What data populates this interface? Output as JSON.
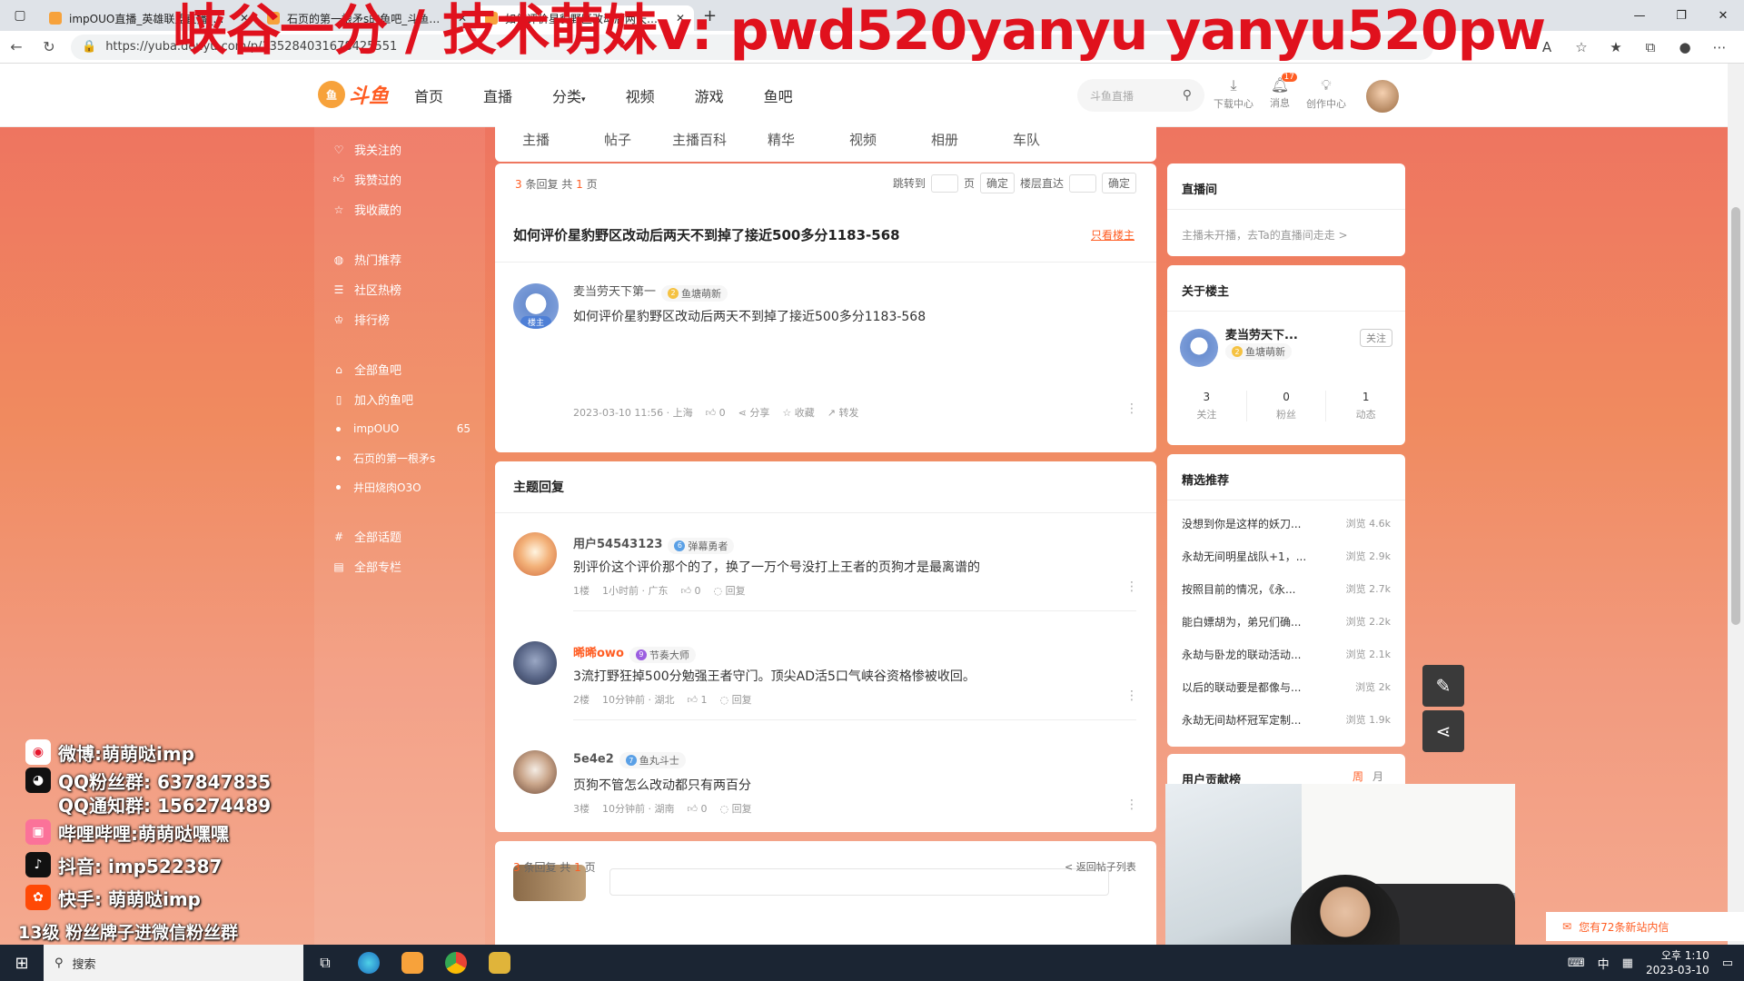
{
  "overlay_title": "峡谷一分 / 技术萌妹v: pwd520yanyu yanyu520pw",
  "browser": {
    "tabs": [
      {
        "title": "impOUO直播_英雄联盟直播_斗鱼直播",
        "active": false
      },
      {
        "title": "石页的第一根矛s的鱼吧_斗鱼直播",
        "active": false
      },
      {
        "title": "如何评价星豹野区改动后两天不到",
        "active": true
      }
    ],
    "url": "https://yuba.douyu.com/p/135284031678425551"
  },
  "site": {
    "logo_text": "斗鱼",
    "nav": [
      "首页",
      "直播",
      "分类",
      "视频",
      "游戏",
      "鱼吧"
    ],
    "search_placeholder": "斗鱼直播",
    "header_icons": [
      {
        "label": "下载中心",
        "icon": "download-icon",
        "badge": ""
      },
      {
        "label": "消息",
        "icon": "bell-icon",
        "badge": "17"
      },
      {
        "label": "创作中心",
        "icon": "bulb-icon",
        "badge": ""
      }
    ]
  },
  "sidebar": {
    "group1": [
      {
        "label": "我关注的",
        "icon": "heart-icon"
      },
      {
        "label": "我赞过的",
        "icon": "thumb-icon"
      },
      {
        "label": "我收藏的",
        "icon": "star-icon"
      }
    ],
    "group2": [
      {
        "label": "热门推荐",
        "icon": "fire-icon"
      },
      {
        "label": "社区热榜",
        "icon": "list-icon"
      },
      {
        "label": "排行榜",
        "icon": "trophy-icon"
      }
    ],
    "group3": [
      {
        "label": "全部鱼吧",
        "icon": "home-icon"
      },
      {
        "label": "加入的鱼吧",
        "icon": "bookmark-icon"
      }
    ],
    "joined": [
      {
        "label": "impOUO",
        "count": "65"
      },
      {
        "label": "石页的第一根矛s",
        "count": ""
      },
      {
        "label": "井田烧肉O3O",
        "count": ""
      }
    ],
    "group4": [
      {
        "label": "全部话题",
        "icon": "hash-icon"
      },
      {
        "label": "全部专栏",
        "icon": "column-icon"
      }
    ]
  },
  "tabstrip": [
    "主播",
    "帖子",
    "主播百科",
    "精华",
    "视频",
    "相册",
    "车队"
  ],
  "post": {
    "pager_count": "3",
    "pager_pages": "1",
    "pager_prefix": "条回复 共",
    "pager_suffix": "页",
    "jump_label": "跳转到",
    "page_label": "页",
    "confirm": "确定",
    "floor_label": "楼层直达",
    "title": "如何评价星豹野区改动后两天不到掉了接近500多分1183-568",
    "only_op": "只看楼主",
    "author": "麦当劳天下第一",
    "author_tag": "楼主",
    "author_level": "鱼塘萌新",
    "body": "如何评价星豹野区改动后两天不到掉了接近500多分1183-568",
    "time": "2023-03-10 11:56 · 上海",
    "likes": "0",
    "share": "分享",
    "fav": "收藏",
    "forward": "转发"
  },
  "replies": {
    "title": "主题回复",
    "items": [
      {
        "user": "用户54543123",
        "level": "弹幕勇者",
        "text": "别评价这个评价那个的了，换了一万个号没打上王者的页狗才是最离谱的",
        "floor": "1楼",
        "time": "1小时前 · 广东",
        "likes": "0",
        "reply": "回复",
        "highlight": false
      },
      {
        "user": "晞晞owo",
        "level": "节奏大师",
        "text": "3流打野狂掉500分勉强王者守门。顶尖AD活5口气峡谷资格惨被收回。",
        "floor": "2楼",
        "time": "10分钟前 · 湖北",
        "likes": "1",
        "reply": "回复",
        "highlight": true
      },
      {
        "user": "5e4e2",
        "level": "鱼丸斗士",
        "text": "页狗不管怎么改动都只有两百分",
        "floor": "3楼",
        "time": "10分钟前 · 湖南",
        "likes": "0",
        "reply": "回复",
        "highlight": false
      }
    ],
    "back": "< 返回帖子列表"
  },
  "right": {
    "live_title": "直播间",
    "live_sub": "主播未开播，去Ta的直播间走走 >",
    "about_title": "关于楼主",
    "about_name": "麦当劳天下...",
    "about_level": "鱼塘萌新",
    "follow": "关注",
    "stats": [
      {
        "value": "3",
        "label": "关注"
      },
      {
        "value": "0",
        "label": "粉丝"
      },
      {
        "value": "1",
        "label": "动态"
      }
    ],
    "rec_title": "精选推荐",
    "rec": [
      {
        "title": "没想到你是这样的妖刀...",
        "views": "浏览 4.6k"
      },
      {
        "title": "永劫无间明星战队+1，...",
        "views": "浏览 2.9k"
      },
      {
        "title": "按照目前的情况，《永...",
        "views": "浏览 2.7k"
      },
      {
        "title": "能白嫖胡为，弟兄们确...",
        "views": "浏览 2.2k"
      },
      {
        "title": "永劫与卧龙的联动活动...",
        "views": "浏览 2.1k"
      },
      {
        "title": "以后的联动要是都像与...",
        "views": "浏览 2k"
      },
      {
        "title": "永劫无间劫杯冠军定制...",
        "views": "浏览 1.9k"
      }
    ],
    "rank_title": "用户贡献榜",
    "week": "周",
    "month": "月"
  },
  "social": [
    {
      "icon": "weibo-icon",
      "text": "微博:萌萌哒imp",
      "color": "#e6162d"
    },
    {
      "icon": "qq-icon",
      "text": "QQ粉丝群: 637847835",
      "color": "#111"
    },
    {
      "icon": "qq-icon",
      "text": "QQ通知群: 156274489",
      "color": "#111"
    },
    {
      "icon": "bilibili-icon",
      "text": "哔哩哔哩:萌萌哒嘿嘿",
      "color": "#fb7299"
    },
    {
      "icon": "douyin-icon",
      "text": "抖音: imp522387",
      "color": "#111"
    },
    {
      "icon": "kuaishou-icon",
      "text": "快手: 萌萌哒imp",
      "color": "#ff4906"
    }
  ],
  "fan_line": "13级 粉丝牌子进微信粉丝群",
  "mail_note": "您有72条新站内信",
  "taskbar": {
    "search": "搜索",
    "time": "오후 1:10",
    "date": "2023-03-10",
    "ime": "中"
  }
}
